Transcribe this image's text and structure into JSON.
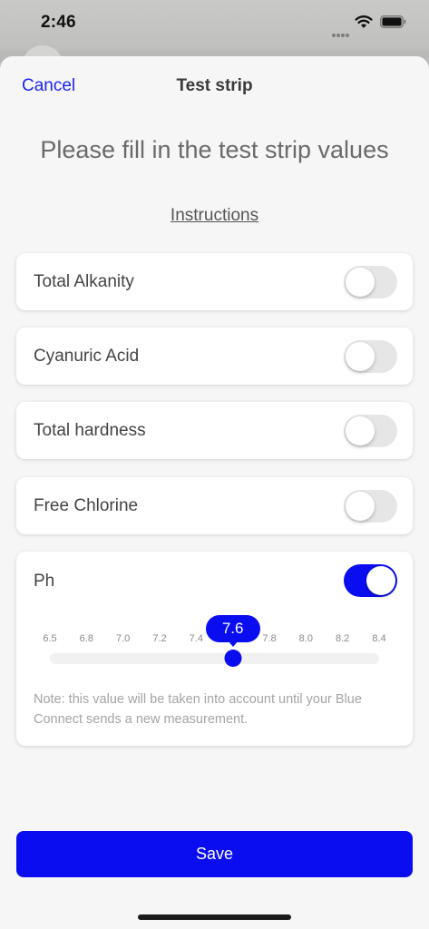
{
  "status_bar": {
    "time": "2:46",
    "icons": [
      "signal-icon",
      "wifi-icon",
      "battery-icon"
    ]
  },
  "nav": {
    "cancel_label": "Cancel",
    "title": "Test strip"
  },
  "headline": "Please fill in the test strip values",
  "instructions_label": "Instructions",
  "parameters": [
    {
      "label": "Total Alkanity",
      "enabled": false
    },
    {
      "label": "Cyanuric Acid",
      "enabled": false
    },
    {
      "label": "Total hardness",
      "enabled": false
    },
    {
      "label": "Free Chlorine",
      "enabled": false
    }
  ],
  "ph": {
    "label": "Ph",
    "enabled": true,
    "ticks": [
      "6.5",
      "6.8",
      "7.0",
      "7.2",
      "7.4",
      "7.6",
      "7.8",
      "8.0",
      "8.2",
      "8.4"
    ],
    "selected_value": "7.6",
    "selected_index": 5,
    "note": "Note: this value will be taken into account until your Blue Connect sends a new measurement."
  },
  "save_label": "Save",
  "colors": {
    "accent": "#0a0df0",
    "link": "#1b24f5",
    "sheet_background": "#f5f6f5"
  }
}
